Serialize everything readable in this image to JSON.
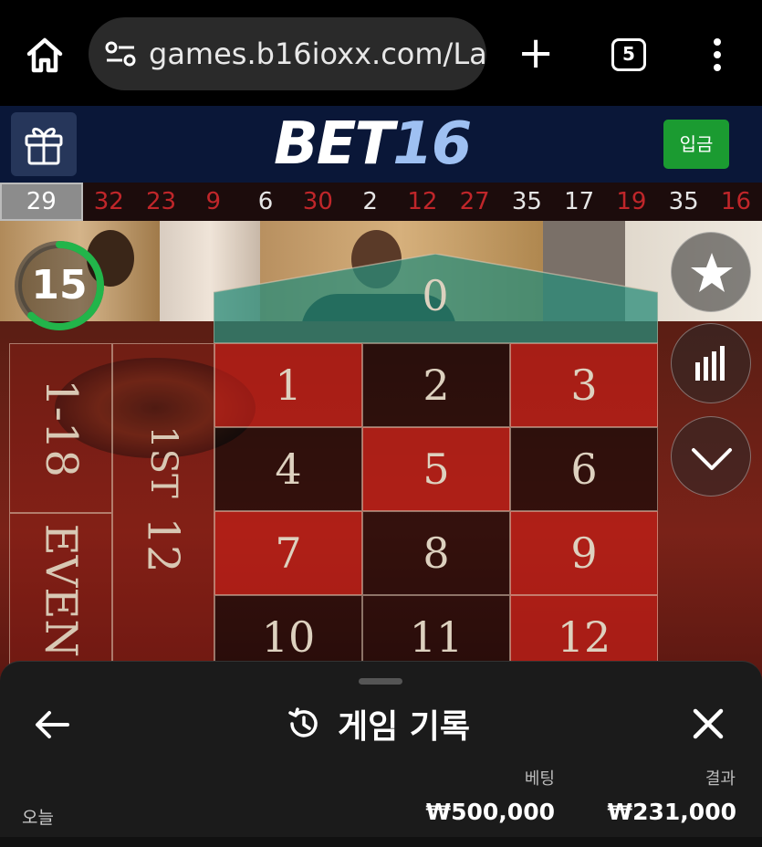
{
  "browser": {
    "url": "games.b16ioxx.com/La",
    "new_tab": "+",
    "tab_count": "5"
  },
  "header": {
    "logo_part1": "BET",
    "logo_part2": "16",
    "deposit_label": "입금"
  },
  "history": [
    {
      "value": "29",
      "color": "gray"
    },
    {
      "value": "32",
      "color": "red"
    },
    {
      "value": "23",
      "color": "red"
    },
    {
      "value": "9",
      "color": "red"
    },
    {
      "value": "6",
      "color": "white"
    },
    {
      "value": "30",
      "color": "red"
    },
    {
      "value": "2",
      "color": "white"
    },
    {
      "value": "12",
      "color": "red"
    },
    {
      "value": "27",
      "color": "red"
    },
    {
      "value": "35",
      "color": "white"
    },
    {
      "value": "17",
      "color": "white"
    },
    {
      "value": "19",
      "color": "red"
    },
    {
      "value": "35",
      "color": "white"
    },
    {
      "value": "16",
      "color": "red"
    }
  ],
  "timer": {
    "seconds": "15",
    "progress": 0.62
  },
  "board": {
    "zero": "0",
    "cells": [
      {
        "n": "1",
        "c": "red"
      },
      {
        "n": "2",
        "c": "black"
      },
      {
        "n": "3",
        "c": "red"
      },
      {
        "n": "4",
        "c": "black"
      },
      {
        "n": "5",
        "c": "red"
      },
      {
        "n": "6",
        "c": "black"
      },
      {
        "n": "7",
        "c": "red"
      },
      {
        "n": "8",
        "c": "black"
      },
      {
        "n": "9",
        "c": "red"
      },
      {
        "n": "10",
        "c": "black"
      },
      {
        "n": "11",
        "c": "black"
      },
      {
        "n": "12",
        "c": "red"
      }
    ],
    "outside_range": "1-18",
    "outside_even": "EVEN",
    "outside_dozen_1st": "1ST",
    "outside_dozen_12": "12"
  },
  "sheet": {
    "title": "게임 기록",
    "col_bet": "베팅",
    "col_result": "결과",
    "rows": [
      {
        "date": "오늘",
        "bet": "₩500,000",
        "result": "₩231,000"
      }
    ]
  },
  "colors": {
    "header_bg": "#0a1738",
    "deposit_green": "#1b9b31",
    "history_red": "#c0262a",
    "logo_accent": "#9ec0f2",
    "zero_green": "#2a8c7a"
  }
}
